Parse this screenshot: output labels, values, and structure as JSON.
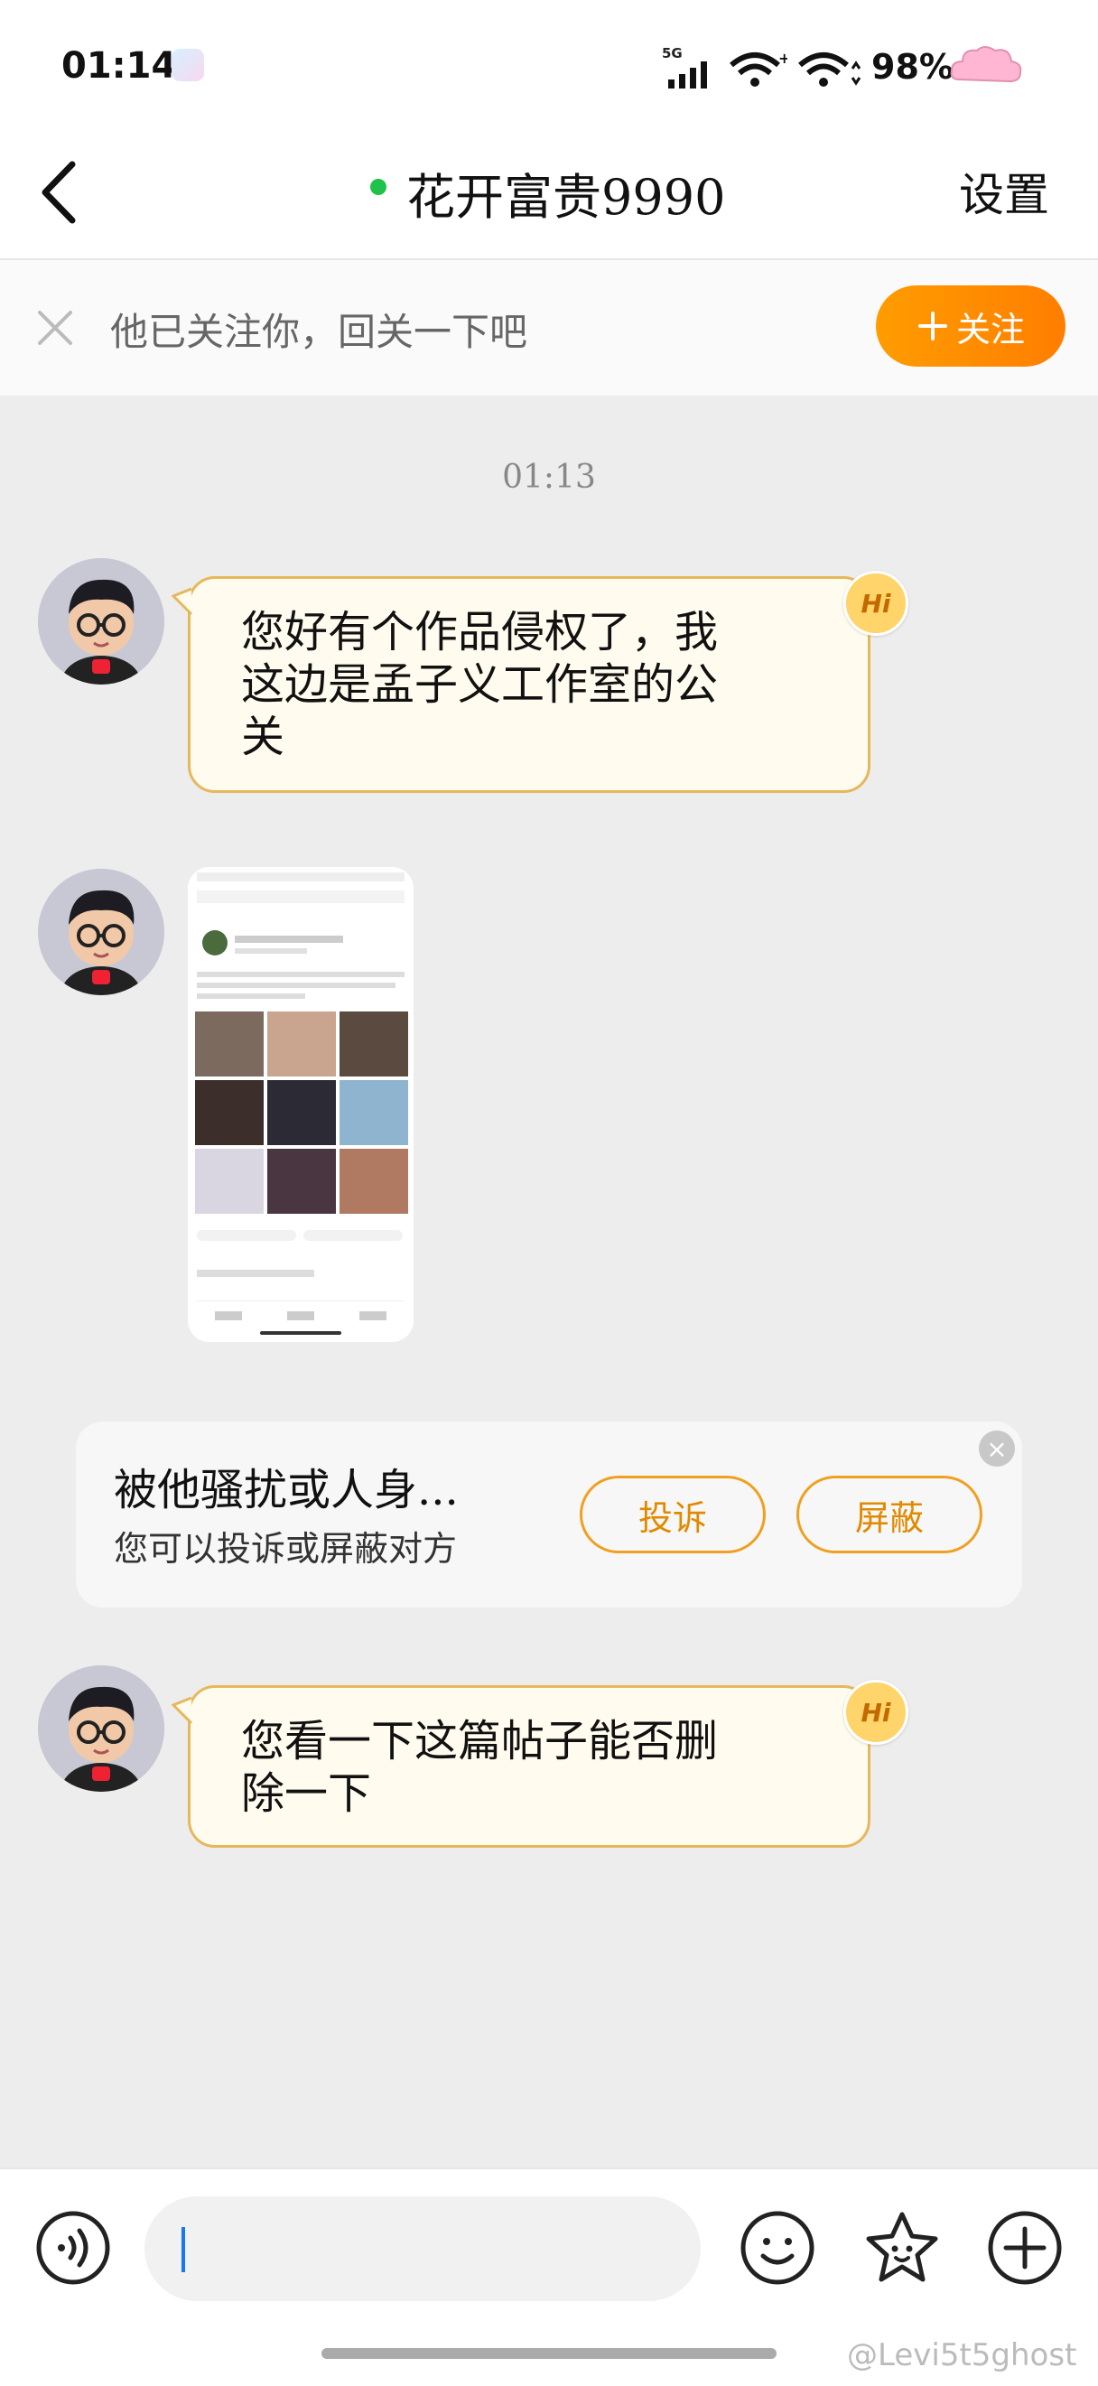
{
  "status": {
    "time": "01:14",
    "network_label": "5G",
    "battery": "98%"
  },
  "nav": {
    "title": "花开富贵9990",
    "settings_label": "设置"
  },
  "follow_bar": {
    "text": "他已关注你，回关一下吧",
    "button_label": "关注"
  },
  "chat": {
    "timestamp": "01:13",
    "messages": [
      {
        "line1": "您好有个作品侵权了，我",
        "line2": "这边是孟子义工作室的公",
        "line3": "关",
        "badge": "Hi"
      },
      {
        "type": "image"
      },
      {
        "line1": "您看一下这篇帖子能否删",
        "line2": "除一下",
        "badge": "Hi"
      }
    ]
  },
  "report_card": {
    "title": "被他骚扰或人身...",
    "subtitle": "您可以投诉或屏蔽对方",
    "report_label": "投诉",
    "block_label": "屏蔽",
    "close_glyph": "×"
  },
  "watermark": "@Levi5t5ghost",
  "colors": {
    "accent": "#ff8a00",
    "bubble_bg": "#fffbee",
    "bubble_border": "#e6b85c",
    "online": "#1fc34a"
  },
  "icons": [
    "back-icon",
    "close-icon",
    "plus-icon",
    "voice-icon",
    "emoji-icon",
    "sticker-icon",
    "add-icon"
  ]
}
